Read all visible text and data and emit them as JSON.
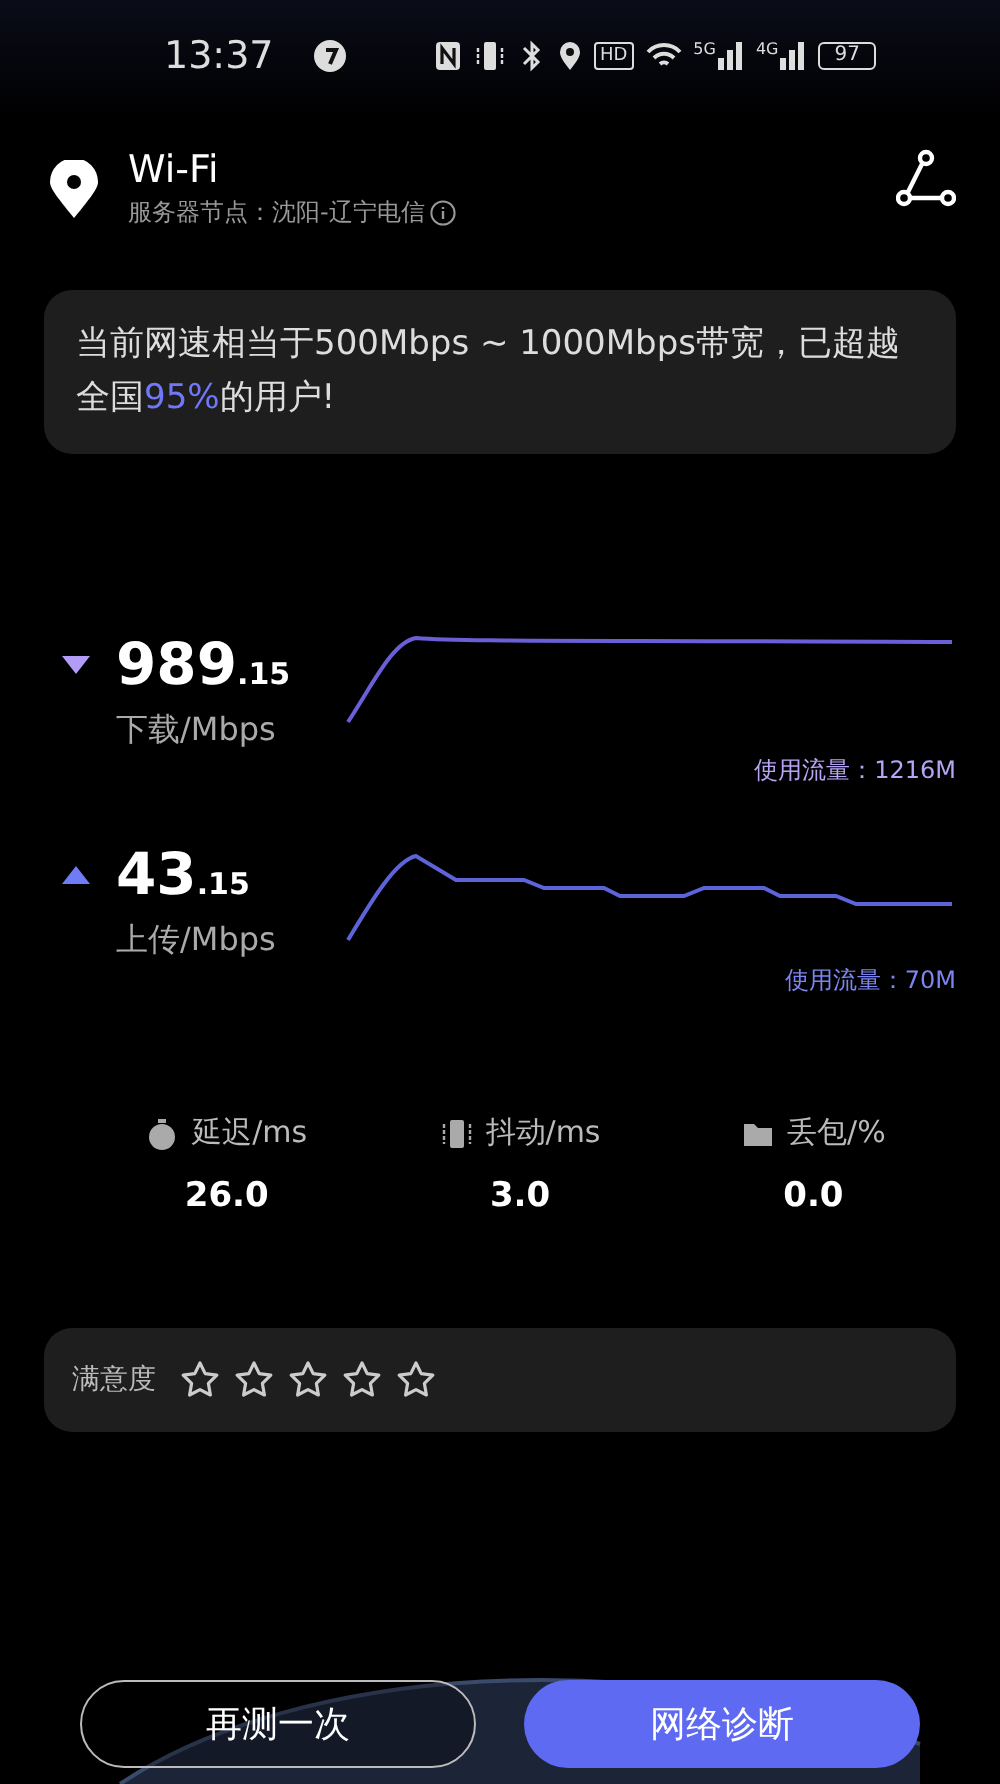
{
  "status_bar": {
    "time": "13:37",
    "hd": "HD",
    "network_5g": "5G",
    "network_4g": "4G",
    "battery": "97"
  },
  "header": {
    "title": "Wi-Fi",
    "server": "服务器节点：沈阳-辽宁电信"
  },
  "summary": "当前网速相当于500Mbps ~ 1000Mbps带宽，已超越全国**95%**的用户!",
  "speeds": [
    {
      "kind": "download",
      "value": "989",
      "decimal": ".15",
      "unit": "下载/Mbps",
      "usage": "使用流量：1216M"
    },
    {
      "kind": "upload",
      "value": "43",
      "decimal": ".15",
      "unit": "上传/Mbps",
      "usage": "使用流量：70M"
    }
  ],
  "metrics": [
    {
      "kind": "latency",
      "label": "延迟/ms",
      "value": "26.0"
    },
    {
      "kind": "jitter",
      "label": "抖动/ms",
      "value": "3.0"
    },
    {
      "kind": "loss",
      "label": "丢包/%",
      "value": "0.0"
    }
  ],
  "rating": {
    "label": "满意度",
    "stars": 0
  },
  "buttons": [
    {
      "label": "再测一次",
      "kind": "outline"
    },
    {
      "label": "网络诊断",
      "kind": "primary"
    }
  ]
}
